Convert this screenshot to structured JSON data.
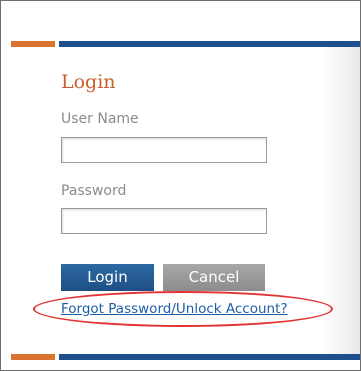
{
  "login_panel": {
    "title": "Login",
    "username_label": "User Name",
    "username_value": "",
    "password_label": "Password",
    "password_value": "",
    "login_button": "Login",
    "cancel_button": "Cancel",
    "forgot_link": "Forgot Password/Unlock Account?"
  },
  "colors": {
    "accent_orange": "#d9742f",
    "accent_blue": "#1e4f8c",
    "title_color": "#c8612b",
    "link_color": "#1e5ea6",
    "highlight_red": "#e23232"
  }
}
